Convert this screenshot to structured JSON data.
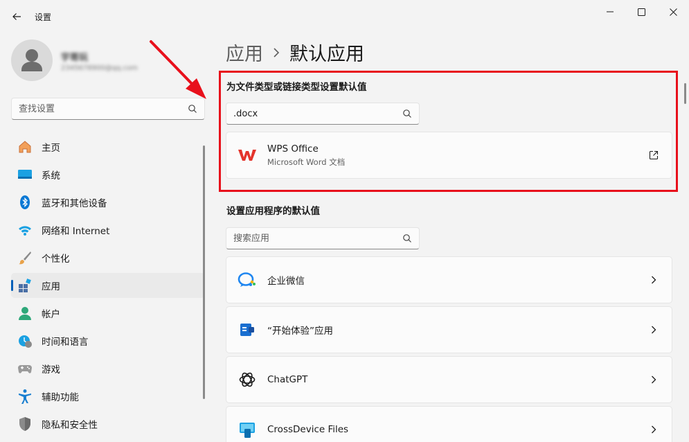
{
  "window": {
    "title": "设置",
    "controls": [
      "minimize",
      "maximize",
      "close"
    ]
  },
  "profile": {
    "name": "宇哥玩",
    "email": "2345678900@qq.com"
  },
  "sidebar": {
    "search_placeholder": "查找设置",
    "items": [
      {
        "label": "主页",
        "icon": "home-icon"
      },
      {
        "label": "系统",
        "icon": "system-icon"
      },
      {
        "label": "蓝牙和其他设备",
        "icon": "bluetooth-icon"
      },
      {
        "label": "网络和 Internet",
        "icon": "wifi-icon"
      },
      {
        "label": "个性化",
        "icon": "brush-icon"
      },
      {
        "label": "应用",
        "icon": "apps-icon",
        "selected": true
      },
      {
        "label": "帐户",
        "icon": "account-icon"
      },
      {
        "label": "时间和语言",
        "icon": "time-language-icon"
      },
      {
        "label": "游戏",
        "icon": "gamepad-icon"
      },
      {
        "label": "辅助功能",
        "icon": "accessibility-icon"
      },
      {
        "label": "隐私和安全性",
        "icon": "shield-icon"
      }
    ]
  },
  "breadcrumb": {
    "parent": "应用",
    "current": "默认应用"
  },
  "file_type_section": {
    "title": "为文件类型或链接类型设置默认值",
    "search_value": ".docx",
    "result": {
      "title": "WPS Office",
      "subtitle": "Microsoft Word 文档",
      "icon": "wps-icon",
      "action_icon": "open-external-icon"
    }
  },
  "apps_section": {
    "title": "设置应用程序的默认值",
    "search_placeholder": "搜索应用",
    "apps": [
      {
        "name": "企业微信",
        "icon": "wecom-icon"
      },
      {
        "name": "“开始体验”应用",
        "icon": "get-started-icon"
      },
      {
        "name": "ChatGPT",
        "icon": "chatgpt-icon"
      },
      {
        "name": "CrossDevice Files",
        "icon": "crossdevice-icon"
      }
    ]
  },
  "colors": {
    "accent": "#005fb8",
    "highlight": "#e8101b",
    "wps_red": "#e4342c"
  }
}
